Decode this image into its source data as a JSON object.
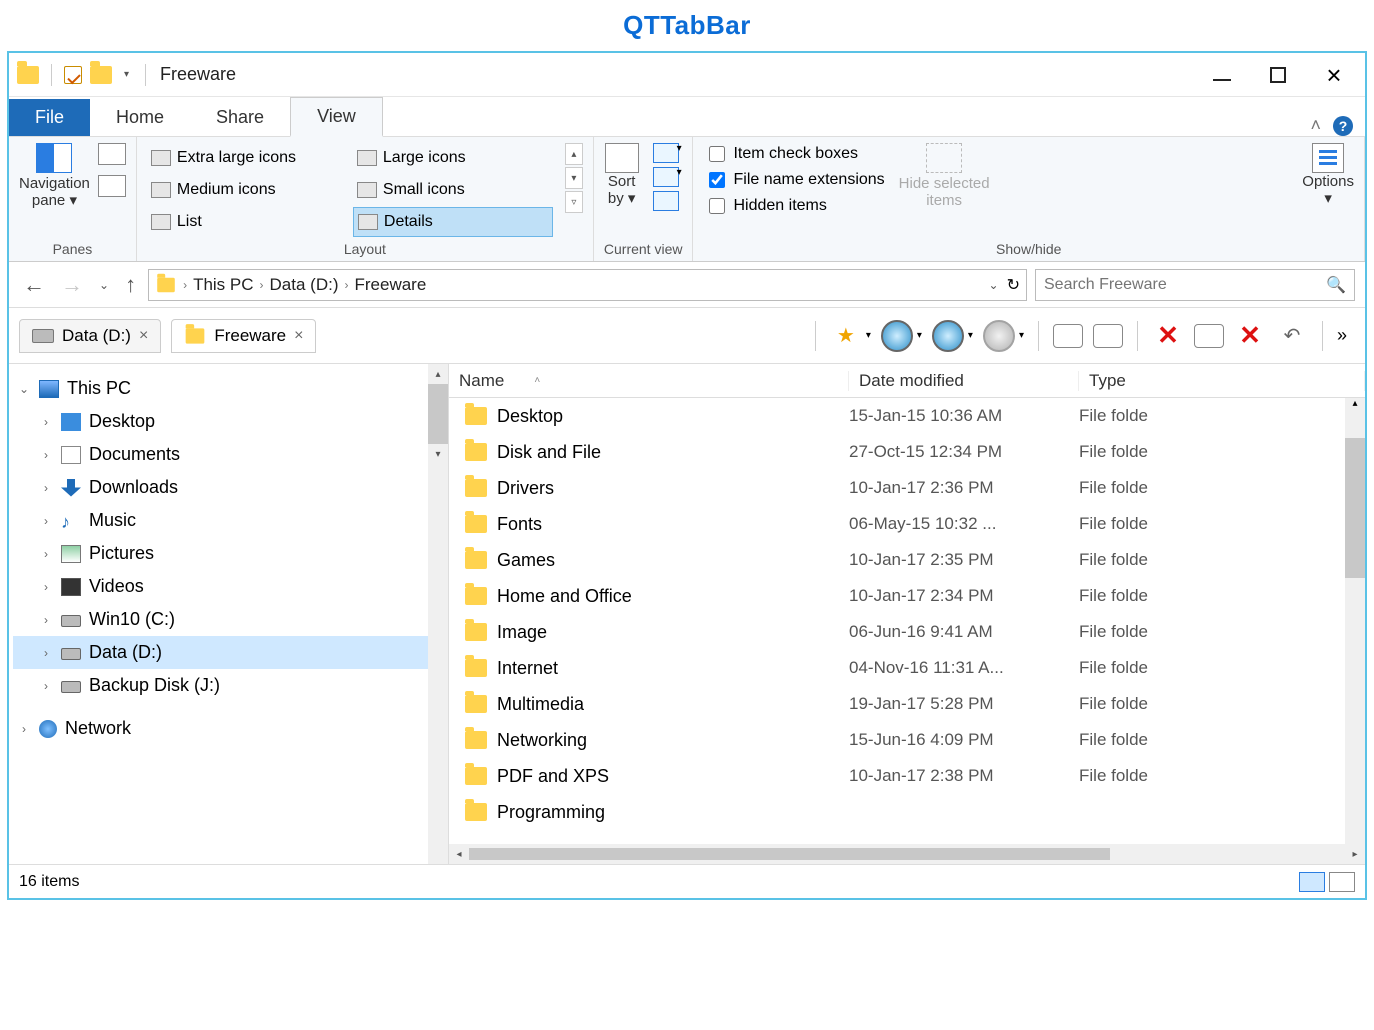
{
  "outer_title": "QTTabBar",
  "titlebar": {
    "title": "Freeware"
  },
  "menu": {
    "file": "File",
    "tabs": [
      "Home",
      "Share",
      "View"
    ],
    "active": "View"
  },
  "ribbon": {
    "panes": {
      "label": "Panes",
      "nav_pane": "Navigation\npane ▾"
    },
    "layout": {
      "label": "Layout",
      "items": [
        "Extra large icons",
        "Large icons",
        "Medium icons",
        "Small icons",
        "List",
        "Details"
      ],
      "selected": "Details"
    },
    "current_view": {
      "label": "Current view",
      "sort_by": "Sort\nby ▾"
    },
    "show_hide": {
      "label": "Show/hide",
      "checks": [
        {
          "label": "Item check boxes",
          "checked": false
        },
        {
          "label": "File name extensions",
          "checked": true
        },
        {
          "label": "Hidden items",
          "checked": false
        }
      ],
      "hide_selected": "Hide selected\nitems"
    },
    "options": "Options"
  },
  "address": {
    "crumbs": [
      "This PC",
      "Data (D:)",
      "Freeware"
    ],
    "search_placeholder": "Search Freeware"
  },
  "qt_tabs": [
    {
      "label": "Data (D:)",
      "active": false,
      "icon": "disk"
    },
    {
      "label": "Freeware",
      "active": true,
      "icon": "folder"
    }
  ],
  "tree": {
    "root": "This PC",
    "items": [
      {
        "label": "Desktop",
        "icon": "folder"
      },
      {
        "label": "Documents",
        "icon": "doc"
      },
      {
        "label": "Downloads",
        "icon": "dl"
      },
      {
        "label": "Music",
        "icon": "music"
      },
      {
        "label": "Pictures",
        "icon": "pic"
      },
      {
        "label": "Videos",
        "icon": "vid"
      },
      {
        "label": "Win10 (C:)",
        "icon": "drive"
      },
      {
        "label": "Data (D:)",
        "icon": "drive",
        "selected": true
      },
      {
        "label": "Backup Disk (J:)",
        "icon": "drive"
      }
    ],
    "network": "Network"
  },
  "list": {
    "columns": {
      "name": "Name",
      "date": "Date modified",
      "type": "Type"
    },
    "rows": [
      {
        "name": "Desktop",
        "date": "15-Jan-15 10:36 AM",
        "type": "File folde"
      },
      {
        "name": "Disk and File",
        "date": "27-Oct-15 12:34 PM",
        "type": "File folde"
      },
      {
        "name": "Drivers",
        "date": "10-Jan-17 2:36 PM",
        "type": "File folde"
      },
      {
        "name": "Fonts",
        "date": "06-May-15 10:32 ...",
        "type": "File folde"
      },
      {
        "name": "Games",
        "date": "10-Jan-17 2:35 PM",
        "type": "File folde"
      },
      {
        "name": "Home and Office",
        "date": "10-Jan-17 2:34 PM",
        "type": "File folde"
      },
      {
        "name": "Image",
        "date": "06-Jun-16 9:41 AM",
        "type": "File folde"
      },
      {
        "name": "Internet",
        "date": "04-Nov-16 11:31 A...",
        "type": "File folde"
      },
      {
        "name": "Multimedia",
        "date": "19-Jan-17 5:28 PM",
        "type": "File folde"
      },
      {
        "name": "Networking",
        "date": "15-Jun-16 4:09 PM",
        "type": "File folde"
      },
      {
        "name": "PDF and XPS",
        "date": "10-Jan-17 2:38 PM",
        "type": "File folde"
      },
      {
        "name": "Programming",
        "date": "",
        "type": ""
      }
    ]
  },
  "status": {
    "text": "16 items"
  }
}
